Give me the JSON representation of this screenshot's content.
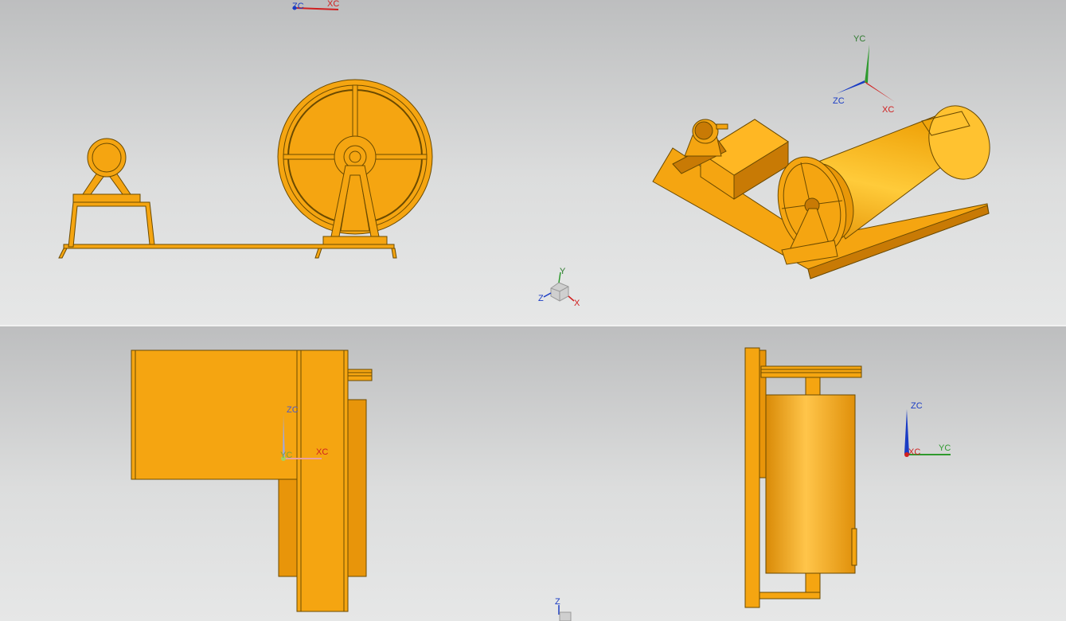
{
  "viewports": [
    {
      "name": "front",
      "triad": {
        "a": "ZC",
        "b": "XC"
      }
    },
    {
      "name": "isometric",
      "triad": {
        "y": "YC",
        "z": "ZC",
        "x": "XC"
      }
    },
    {
      "name": "top",
      "triad": {
        "z": "ZC",
        "y": "YC",
        "x": "XC"
      }
    },
    {
      "name": "right",
      "triad": {
        "z": "ZC",
        "x": "XC",
        "y": "YC"
      }
    }
  ],
  "view_cube": {
    "y": "Y",
    "z": "Z",
    "x": "X"
  },
  "bottom_cube": {
    "z": "Z"
  },
  "colors": {
    "part": "#f5a511",
    "part_dark": "#c87a05",
    "outline": "#6b4a00",
    "bg_top": "#bdbebf",
    "bg_bottom": "#e6e7e7"
  }
}
